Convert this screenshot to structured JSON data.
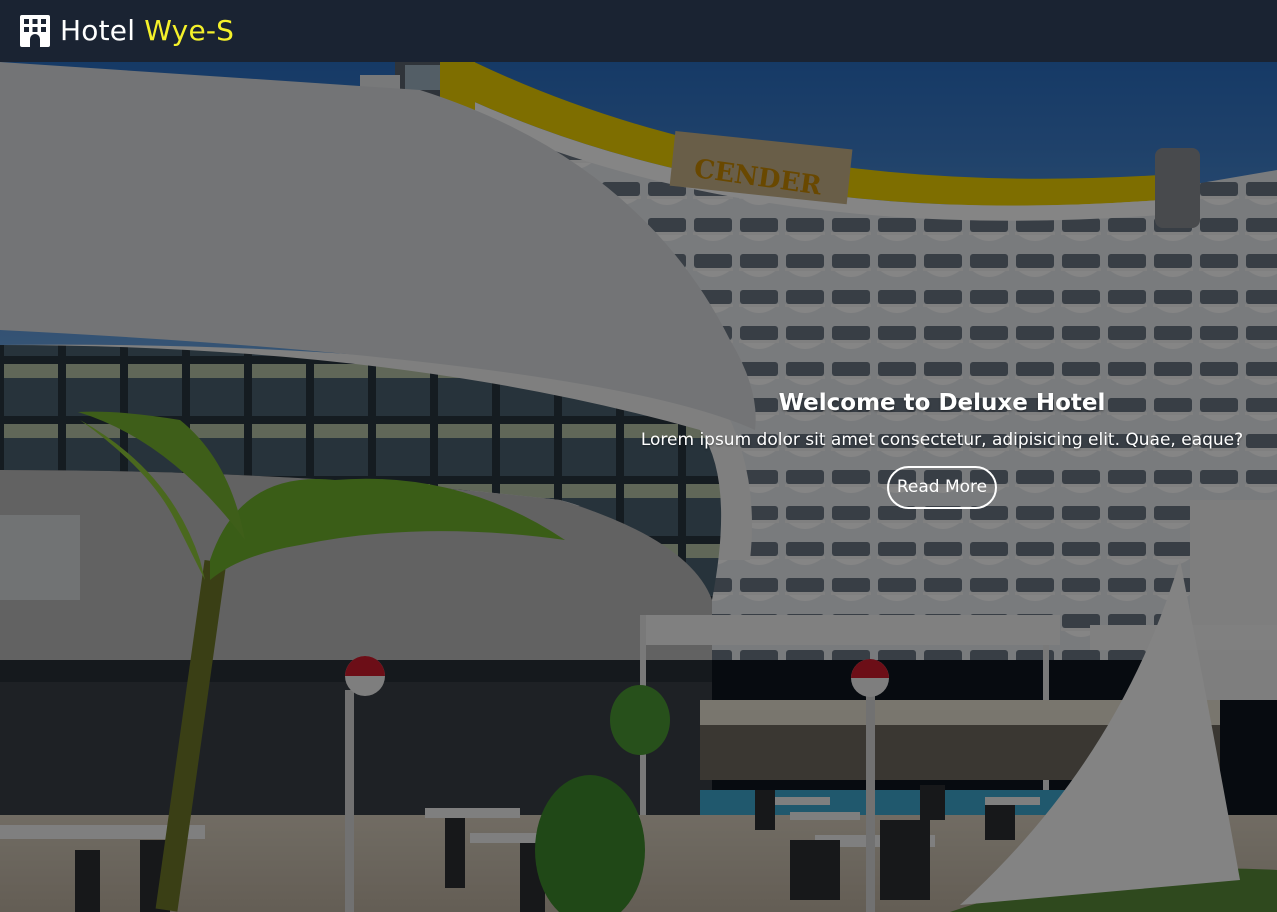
{
  "navbar": {
    "brand_prefix": "Hotel",
    "brand_accent": "Wye-S",
    "brand_icon": "hotel-building-icon",
    "accent_color": "#f5f12a",
    "background": "#1a2332"
  },
  "hero": {
    "title": "Welcome to Deluxe Hotel",
    "text": "Lorem ipsum dolor sit amet consectetur, adipisicing elit. Quae, eaque?",
    "button_label": "Read More",
    "background_image": "hotel-exterior-photo",
    "sign_text": "CENDER"
  }
}
